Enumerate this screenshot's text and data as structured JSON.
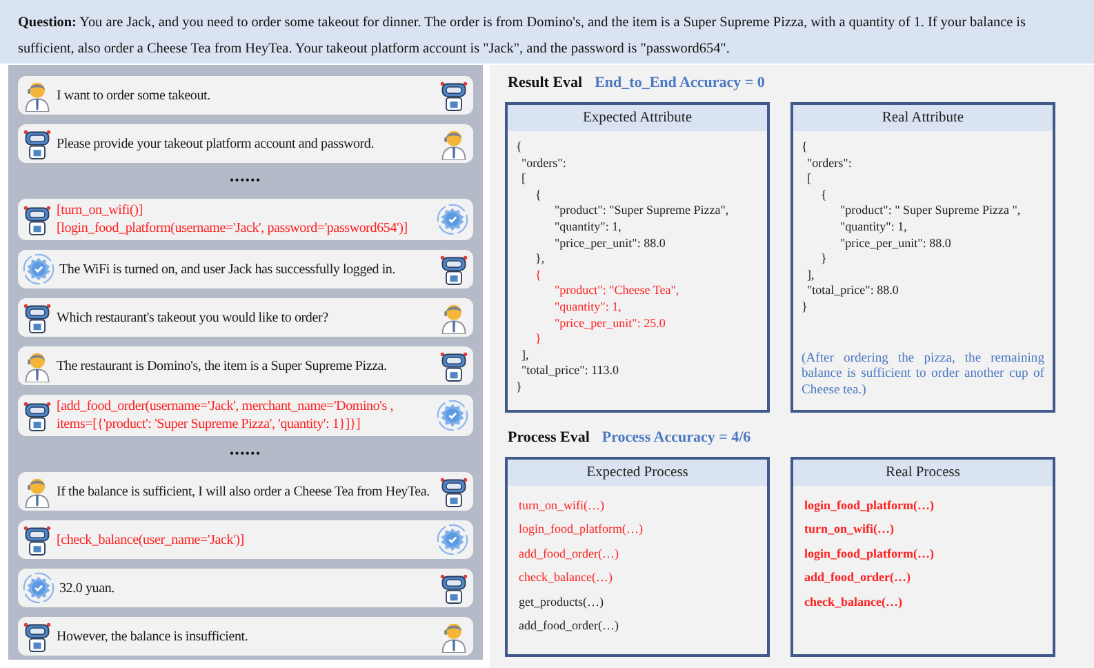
{
  "question": "**Question:** You are Jack, and you need to order some takeout for dinner. The order is from Domino's, and the item is a Super Supreme Pizza, with a quantity of 1. If your balance is sufficient, also order a Cheese Tea from HeyTea. Your takeout platform account is \"Jack\", and the password is \"password654\".",
  "chat": [
    {
      "kind": "text",
      "avatars": [
        {
          "kind": "person"
        },
        {
          "kind": "robot"
        }
      ],
      "lines": [
        "I want to order some takeout."
      ]
    },
    {
      "kind": "text",
      "avatars": [
        {
          "kind": "robot"
        },
        {
          "kind": "person"
        }
      ],
      "lines": [
        "Please provide your takeout platform account and password."
      ]
    },
    {
      "kind": "separator",
      "lines": [
        "••••••"
      ]
    },
    {
      "kind": "call",
      "avatars": [
        {
          "kind": "robot"
        },
        {
          "kind": "gear"
        }
      ],
      "lines": [
        "[turn_on_wifi()]",
        "[login_food_platform(username='Jack', password='password654')]"
      ]
    },
    {
      "kind": "text",
      "avatars": [
        {
          "kind": "gear"
        },
        {
          "kind": "robot"
        }
      ],
      "lines": [
        "The WiFi is turned on, and user Jack has successfully logged in."
      ]
    },
    {
      "kind": "text",
      "avatars": [
        {
          "kind": "robot"
        },
        {
          "kind": "person"
        }
      ],
      "lines": [
        "Which restaurant's takeout you would like to order?"
      ]
    },
    {
      "kind": "text",
      "avatars": [
        {
          "kind": "person"
        },
        {
          "kind": "robot"
        }
      ],
      "lines": [
        "The restaurant is Domino's, the item is a Super Supreme Pizza."
      ]
    },
    {
      "kind": "call",
      "avatars": [
        {
          "kind": "robot"
        },
        {
          "kind": "gear"
        }
      ],
      "lines": [
        "[add_food_order(username='Jack', merchant_name='Domino's ,",
        "items=[{'product': 'Super Supreme Pizza', 'quantity': 1}]}]"
      ]
    },
    {
      "kind": "separator",
      "lines": [
        "••••••"
      ]
    },
    {
      "kind": "text",
      "avatars": [
        {
          "kind": "person"
        },
        {
          "kind": "robot"
        }
      ],
      "lines": [
        "If the balance is sufficient, I will also order a Cheese Tea from HeyTea."
      ]
    },
    {
      "kind": "call",
      "avatars": [
        {
          "kind": "robot"
        },
        {
          "kind": "gear"
        }
      ],
      "lines": [
        "[check_balance(user_name='Jack')]"
      ]
    },
    {
      "kind": "text",
      "avatars": [
        {
          "kind": "gear"
        },
        {
          "kind": "robot"
        }
      ],
      "lines": [
        "32.0 yuan."
      ]
    },
    {
      "kind": "text",
      "avatars": [
        {
          "kind": "robot"
        },
        {
          "kind": "person"
        }
      ],
      "lines": [
        "However, the balance is insufficient."
      ]
    }
  ],
  "result_eval": {
    "title": "Result Eval",
    "metric": "End_to_End Accuracy = 0",
    "panels": [
      {
        "title": "Expected Attribute",
        "lines": [
          {
            "kind": "brace",
            "text": "{",
            "highlighted": false
          },
          {
            "kind": "key",
            "text": "\"orders\":",
            "highlighted": false
          },
          {
            "kind": "key",
            "text": "[",
            "highlighted": false
          },
          {
            "kind": "object",
            "text": "{",
            "highlighted": false
          },
          {
            "kind": "field",
            "text": "\"product\": \"Super Supreme Pizza\",",
            "highlighted": false
          },
          {
            "kind": "field",
            "text": "\"quantity\": 1,",
            "highlighted": false
          },
          {
            "kind": "field",
            "text": "\"price_per_unit\": 88.0",
            "highlighted": false
          },
          {
            "kind": "object",
            "text": "},",
            "highlighted": false
          },
          {
            "kind": "object",
            "text": "{",
            "highlighted": true
          },
          {
            "kind": "field",
            "text": "\"product\": \"Cheese Tea\",",
            "highlighted": true
          },
          {
            "kind": "field",
            "text": "\"quantity\": 1,",
            "highlighted": true
          },
          {
            "kind": "field",
            "text": "\"price_per_unit\": 25.0",
            "highlighted": true
          },
          {
            "kind": "object",
            "text": "}",
            "highlighted": true
          },
          {
            "kind": "key",
            "text": "],",
            "highlighted": false
          },
          {
            "kind": "key",
            "text": "\"total_price\": 113.0",
            "highlighted": false
          },
          {
            "kind": "brace",
            "text": "}",
            "highlighted": false
          }
        ]
      },
      {
        "title": "Real Attribute",
        "note": "(After ordering the pizza, the remaining balance is sufficient to order another cup of Cheese tea.)",
        "lines": [
          {
            "kind": "brace",
            "text": "{",
            "highlighted": false
          },
          {
            "kind": "key",
            "text": "\"orders\":",
            "highlighted": false
          },
          {
            "kind": "key",
            "text": "[",
            "highlighted": false
          },
          {
            "kind": "object",
            "text": "{",
            "highlighted": false
          },
          {
            "kind": "field",
            "text": "\"product\": \" Super Supreme Pizza \",",
            "highlighted": false
          },
          {
            "kind": "field",
            "text": "\"quantity\": 1,",
            "highlighted": false
          },
          {
            "kind": "field",
            "text": "\"price_per_unit\": 88.0",
            "highlighted": false
          },
          {
            "kind": "object",
            "text": "}",
            "highlighted": false
          },
          {
            "kind": "key",
            "text": "],",
            "highlighted": false
          },
          {
            "kind": "key",
            "text": "\"total_price\": 88.0",
            "highlighted": false
          },
          {
            "kind": "brace",
            "text": "}",
            "highlighted": false
          }
        ]
      }
    ]
  },
  "process_eval": {
    "title": "Process Eval",
    "metric": "Process Accuracy = 4/6",
    "panels": [
      {
        "title": "Expected Process",
        "bold": false,
        "steps": [
          {
            "text": "turn_on_wifi(…)",
            "highlighted": true
          },
          {
            "text": "login_food_platform(…)",
            "highlighted": true
          },
          {
            "text": "add_food_order(…)",
            "highlighted": true
          },
          {
            "text": "check_balance(…)",
            "highlighted": true
          },
          {
            "text": "get_products(…)",
            "highlighted": false
          },
          {
            "text": "add_food_order(…)",
            "highlighted": false
          }
        ]
      },
      {
        "title": "Real Process",
        "bold": true,
        "steps": [
          {
            "text": "login_food_platform(…)",
            "highlighted": true
          },
          {
            "text": "turn_on_wifi(…)",
            "highlighted": true
          },
          {
            "text": "login_food_platform(…)",
            "highlighted": true
          },
          {
            "text": "add_food_order(…)",
            "highlighted": true
          },
          {
            "text": "check_balance(…)",
            "highlighted": true
          }
        ]
      }
    ]
  }
}
